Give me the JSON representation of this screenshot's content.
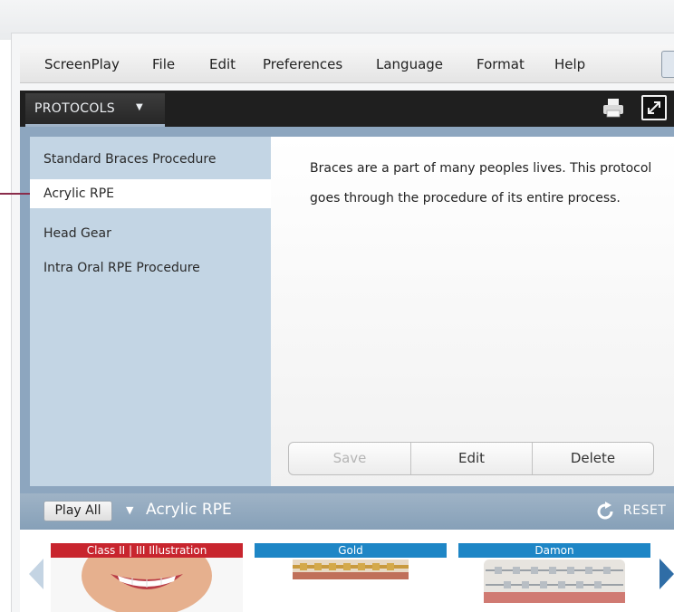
{
  "menubar": {
    "items": [
      "ScreenPlay",
      "File",
      "Edit",
      "Preferences",
      "Language",
      "Format",
      "Help"
    ]
  },
  "header": {
    "tab_label": "PROTOCOLS",
    "icons": [
      "dropdown-arrow-icon",
      "print-icon",
      "expand-icon"
    ]
  },
  "sidebar": {
    "items": [
      {
        "label": "Standard Braces Procedure",
        "selected": false
      },
      {
        "label": "Acrylic RPE",
        "selected": true
      },
      {
        "label": "Head Gear",
        "selected": false
      },
      {
        "label": "Intra Oral RPE Procedure",
        "selected": false
      }
    ]
  },
  "content": {
    "description": "Braces are a part of many peoples lives. This protocol goes through the procedure of its entire process."
  },
  "actions": {
    "save": "Save",
    "edit": "Edit",
    "delete": "Delete"
  },
  "playbar": {
    "play_all": "Play All",
    "current": "Acrylic RPE",
    "reset": "RESET"
  },
  "thumbnails": [
    {
      "label": "Class II | III Illustration",
      "label_color": "#c8252e"
    },
    {
      "label": "Gold",
      "label_color": "#1e86c6"
    },
    {
      "label": "Damon",
      "label_color": "#1e86c6"
    }
  ],
  "colors": {
    "dark_header": "#1f1f1f",
    "panel_blue": "#8da6bf",
    "sidebar_bg": "#c3d5e4",
    "callout_line": "#8a2c4b"
  }
}
